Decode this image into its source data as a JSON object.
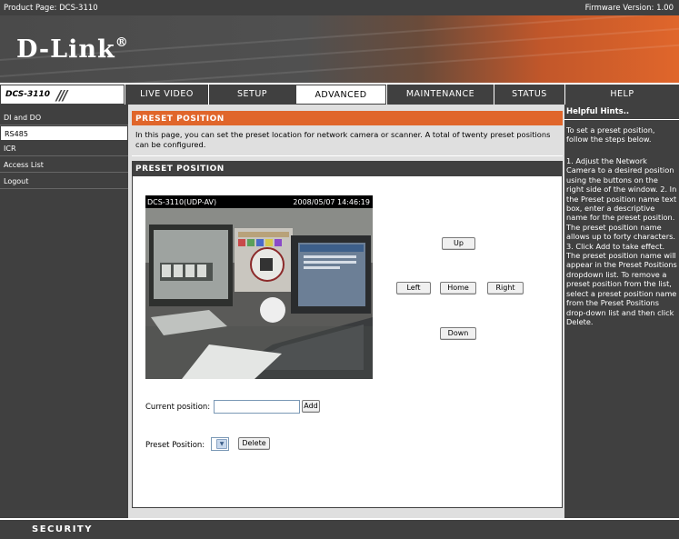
{
  "topbar": {
    "product": "Product Page: DCS-3110",
    "firmware": "Firmware Version: 1.00"
  },
  "logo": {
    "text": "D-Link",
    "mark": "®"
  },
  "model": {
    "name": "DCS-3110",
    "slashes": "///"
  },
  "tabs": [
    {
      "label": "LIVE VIDEO",
      "active": false
    },
    {
      "label": "SETUP",
      "active": false
    },
    {
      "label": "ADVANCED",
      "active": true
    },
    {
      "label": "MAINTENANCE",
      "active": false
    },
    {
      "label": "STATUS",
      "active": false
    },
    {
      "label": "HELP",
      "active": false
    }
  ],
  "sidebar": {
    "items": [
      {
        "label": "DI and DO",
        "active": false
      },
      {
        "label": "RS485",
        "active": true
      },
      {
        "label": "ICR",
        "active": false
      },
      {
        "label": "Access List",
        "active": false
      },
      {
        "label": "Logout",
        "active": false
      }
    ]
  },
  "main": {
    "section_title": "PRESET POSITION",
    "intro": "In this page, you can set the preset location for network camera or scanner. A total of twenty preset positions can be configured.",
    "panel_title": "PRESET POSITION",
    "camera": {
      "caption_left": "DCS-3110(UDP-AV)",
      "caption_right": "2008/05/07 14:46:19"
    },
    "ptz": {
      "up": "Up",
      "left": "Left",
      "home": "Home",
      "right": "Right",
      "down": "Down"
    },
    "current_position": {
      "label": "Current position:",
      "value": "",
      "add": "Add"
    },
    "preset_position": {
      "label": "Preset Position:",
      "selected": "",
      "delete": "Delete"
    }
  },
  "help": {
    "title": "Helpful Hints..",
    "p1": "To set a preset position, follow the steps below.",
    "p2": "1. Adjust the Network Camera to a desired position using the buttons on the right side of the window. 2. In the Preset position name text box, enter a descriptive name for the preset position. The preset position name allows up to forty characters. 3. Click Add to take effect. The preset position name will appear in the Preset Positions dropdown list. To remove a preset position from the list, select a preset position name from the Preset Positions drop-down list and then click Delete."
  },
  "footer": {
    "label": "SECURITY"
  },
  "colors": {
    "orange": "#e0662b",
    "dark_gray": "#404040",
    "panel_gray": "#dfdfdf"
  }
}
